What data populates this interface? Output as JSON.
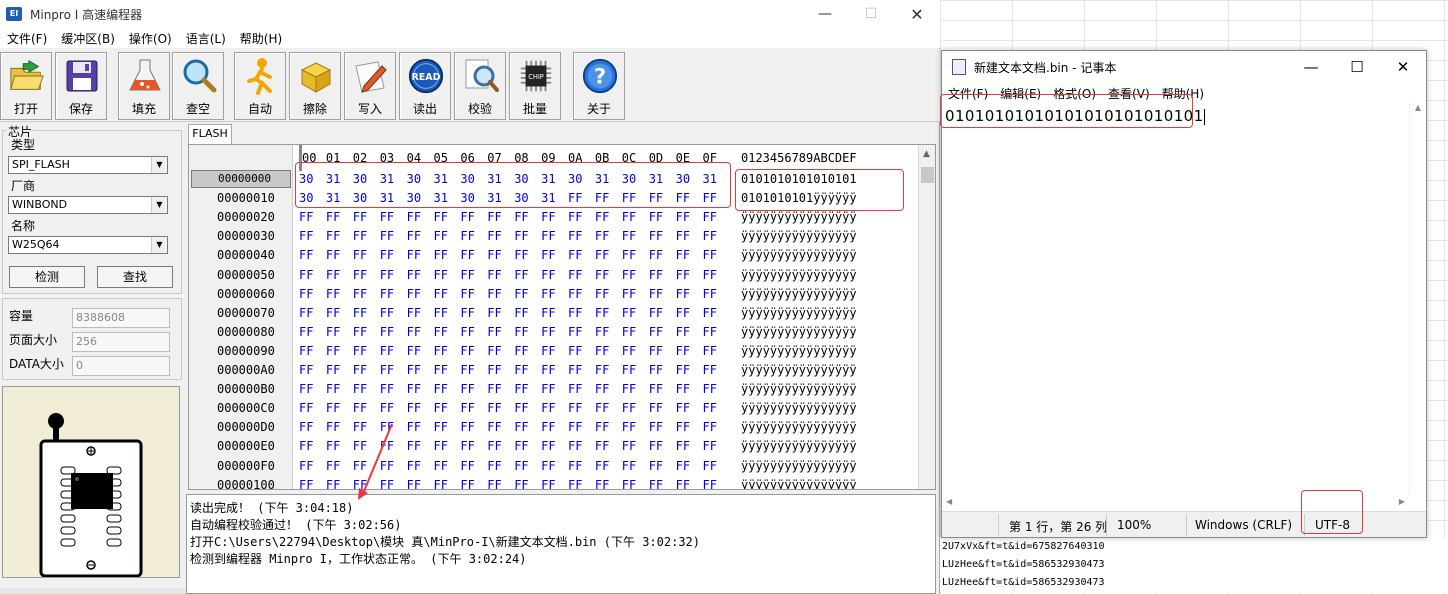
{
  "minpro": {
    "title": "Minpro I 高速编程器",
    "app_icon": "EI",
    "menu": [
      "文件(F)",
      "缓冲区(B)",
      "操作(O)",
      "语言(L)",
      "帮助(H)"
    ],
    "toolbar": [
      {
        "label": "打开",
        "icon": "open-folder-icon"
      },
      {
        "label": "保存",
        "icon": "floppy-disk-icon"
      },
      {
        "label": "填充",
        "icon": "flask-icon"
      },
      {
        "label": "查空",
        "icon": "magnifier-icon"
      },
      {
        "label": "自动",
        "icon": "running-man-icon"
      },
      {
        "label": "擦除",
        "icon": "box-icon"
      },
      {
        "label": "写入",
        "icon": "pencil-paper-icon"
      },
      {
        "label": "读出",
        "icon": "read-icon"
      },
      {
        "label": "校验",
        "icon": "magnify-doc-icon"
      },
      {
        "label": "批量",
        "icon": "chip-icon"
      },
      {
        "label": "关于",
        "icon": "help-icon"
      }
    ],
    "read_icon_text": "READ",
    "chip_icon_text": "CHIP",
    "chip_group": {
      "title": "芯片",
      "type_label": "类型",
      "type_value": "SPI_FLASH",
      "vendor_label": "厂商",
      "vendor_value": "WINBOND",
      "name_label": "名称",
      "name_value": "W25Q64",
      "detect_button": "检测",
      "search_button": "查找"
    },
    "info": {
      "capacity_label": "容量",
      "capacity_value": "8388608",
      "page_size_label": "页面大小",
      "page_size_value": "256",
      "data_size_label": "DATA大小",
      "data_size_value": "0"
    },
    "buffer_tab": "FLASH",
    "hex_header": [
      "00",
      "01",
      "02",
      "03",
      "04",
      "05",
      "06",
      "07",
      "08",
      "09",
      "0A",
      "0B",
      "0C",
      "0D",
      "0E",
      "0F"
    ],
    "ascii_header": "0123456789ABCDEF",
    "hex_rows": [
      {
        "addr": "00000000",
        "bytes": [
          "30",
          "31",
          "30",
          "31",
          "30",
          "31",
          "30",
          "31",
          "30",
          "31",
          "30",
          "31",
          "30",
          "31",
          "30",
          "31"
        ],
        "ascii": "0101010101010101"
      },
      {
        "addr": "00000010",
        "bytes": [
          "30",
          "31",
          "30",
          "31",
          "30",
          "31",
          "30",
          "31",
          "30",
          "31",
          "FF",
          "FF",
          "FF",
          "FF",
          "FF",
          "FF"
        ],
        "ascii": "0101010101ÿÿÿÿÿÿ"
      },
      {
        "addr": "00000020",
        "bytes": [
          "FF",
          "FF",
          "FF",
          "FF",
          "FF",
          "FF",
          "FF",
          "FF",
          "FF",
          "FF",
          "FF",
          "FF",
          "FF",
          "FF",
          "FF",
          "FF"
        ],
        "ascii": "ÿÿÿÿÿÿÿÿÿÿÿÿÿÿÿÿ"
      },
      {
        "addr": "00000030",
        "bytes": [
          "FF",
          "FF",
          "FF",
          "FF",
          "FF",
          "FF",
          "FF",
          "FF",
          "FF",
          "FF",
          "FF",
          "FF",
          "FF",
          "FF",
          "FF",
          "FF"
        ],
        "ascii": "ÿÿÿÿÿÿÿÿÿÿÿÿÿÿÿÿ"
      },
      {
        "addr": "00000040",
        "bytes": [
          "FF",
          "FF",
          "FF",
          "FF",
          "FF",
          "FF",
          "FF",
          "FF",
          "FF",
          "FF",
          "FF",
          "FF",
          "FF",
          "FF",
          "FF",
          "FF"
        ],
        "ascii": "ÿÿÿÿÿÿÿÿÿÿÿÿÿÿÿÿ"
      },
      {
        "addr": "00000050",
        "bytes": [
          "FF",
          "FF",
          "FF",
          "FF",
          "FF",
          "FF",
          "FF",
          "FF",
          "FF",
          "FF",
          "FF",
          "FF",
          "FF",
          "FF",
          "FF",
          "FF"
        ],
        "ascii": "ÿÿÿÿÿÿÿÿÿÿÿÿÿÿÿÿ"
      },
      {
        "addr": "00000060",
        "bytes": [
          "FF",
          "FF",
          "FF",
          "FF",
          "FF",
          "FF",
          "FF",
          "FF",
          "FF",
          "FF",
          "FF",
          "FF",
          "FF",
          "FF",
          "FF",
          "FF"
        ],
        "ascii": "ÿÿÿÿÿÿÿÿÿÿÿÿÿÿÿÿ"
      },
      {
        "addr": "00000070",
        "bytes": [
          "FF",
          "FF",
          "FF",
          "FF",
          "FF",
          "FF",
          "FF",
          "FF",
          "FF",
          "FF",
          "FF",
          "FF",
          "FF",
          "FF",
          "FF",
          "FF"
        ],
        "ascii": "ÿÿÿÿÿÿÿÿÿÿÿÿÿÿÿÿ"
      },
      {
        "addr": "00000080",
        "bytes": [
          "FF",
          "FF",
          "FF",
          "FF",
          "FF",
          "FF",
          "FF",
          "FF",
          "FF",
          "FF",
          "FF",
          "FF",
          "FF",
          "FF",
          "FF",
          "FF"
        ],
        "ascii": "ÿÿÿÿÿÿÿÿÿÿÿÿÿÿÿÿ"
      },
      {
        "addr": "00000090",
        "bytes": [
          "FF",
          "FF",
          "FF",
          "FF",
          "FF",
          "FF",
          "FF",
          "FF",
          "FF",
          "FF",
          "FF",
          "FF",
          "FF",
          "FF",
          "FF",
          "FF"
        ],
        "ascii": "ÿÿÿÿÿÿÿÿÿÿÿÿÿÿÿÿ"
      },
      {
        "addr": "000000A0",
        "bytes": [
          "FF",
          "FF",
          "FF",
          "FF",
          "FF",
          "FF",
          "FF",
          "FF",
          "FF",
          "FF",
          "FF",
          "FF",
          "FF",
          "FF",
          "FF",
          "FF"
        ],
        "ascii": "ÿÿÿÿÿÿÿÿÿÿÿÿÿÿÿÿ"
      },
      {
        "addr": "000000B0",
        "bytes": [
          "FF",
          "FF",
          "FF",
          "FF",
          "FF",
          "FF",
          "FF",
          "FF",
          "FF",
          "FF",
          "FF",
          "FF",
          "FF",
          "FF",
          "FF",
          "FF"
        ],
        "ascii": "ÿÿÿÿÿÿÿÿÿÿÿÿÿÿÿÿ"
      },
      {
        "addr": "000000C0",
        "bytes": [
          "FF",
          "FF",
          "FF",
          "FF",
          "FF",
          "FF",
          "FF",
          "FF",
          "FF",
          "FF",
          "FF",
          "FF",
          "FF",
          "FF",
          "FF",
          "FF"
        ],
        "ascii": "ÿÿÿÿÿÿÿÿÿÿÿÿÿÿÿÿ"
      },
      {
        "addr": "000000D0",
        "bytes": [
          "FF",
          "FF",
          "FF",
          "FF",
          "FF",
          "FF",
          "FF",
          "FF",
          "FF",
          "FF",
          "FF",
          "FF",
          "FF",
          "FF",
          "FF",
          "FF"
        ],
        "ascii": "ÿÿÿÿÿÿÿÿÿÿÿÿÿÿÿÿ"
      },
      {
        "addr": "000000E0",
        "bytes": [
          "FF",
          "FF",
          "FF",
          "FF",
          "FF",
          "FF",
          "FF",
          "FF",
          "FF",
          "FF",
          "FF",
          "FF",
          "FF",
          "FF",
          "FF",
          "FF"
        ],
        "ascii": "ÿÿÿÿÿÿÿÿÿÿÿÿÿÿÿÿ"
      },
      {
        "addr": "000000F0",
        "bytes": [
          "FF",
          "FF",
          "FF",
          "FF",
          "FF",
          "FF",
          "FF",
          "FF",
          "FF",
          "FF",
          "FF",
          "FF",
          "FF",
          "FF",
          "FF",
          "FF"
        ],
        "ascii": "ÿÿÿÿÿÿÿÿÿÿÿÿÿÿÿÿ"
      },
      {
        "addr": "00000100",
        "bytes": [
          "FF",
          "FF",
          "FF",
          "FF",
          "FF",
          "FF",
          "FF",
          "FF",
          "FF",
          "FF",
          "FF",
          "FF",
          "FF",
          "FF",
          "FF",
          "FF"
        ],
        "ascii": "ÿÿÿÿÿÿÿÿÿÿÿÿÿÿÿÿ"
      }
    ],
    "log": [
      "读出完成！ (下午 3:04:18)",
      "自动编程校验通过！ (下午 3:02:56)",
      "打开C:\\Users\\22794\\Desktop\\模块 真\\MinPro-I\\新建文本文档.bin (下午 3:02:32)",
      "检测到编程器 Minpro I，工作状态正常。 (下午 3:02:24)"
    ]
  },
  "notepad": {
    "title": "新建文本文档.bin - 记事本",
    "menu": [
      "文件(F)",
      "编辑(E)",
      "格式(O)",
      "查看(V)",
      "帮助(H)"
    ],
    "content": "01010101010101010101010101",
    "status": {
      "position": "第 1 行，第 26 列",
      "zoom": "100%",
      "line_ending": "Windows (CRLF)",
      "encoding": "UTF-8"
    }
  },
  "background": {
    "rows": [
      "2U7xVx&ft=t&id=675827640310",
      "LUzHee&ft=t&id=586532930473",
      "LUzHee&ft=t&id=586532930473"
    ]
  },
  "colors": {
    "hex_blue": "#0000e0",
    "highlight_red": "#e23b3b"
  }
}
